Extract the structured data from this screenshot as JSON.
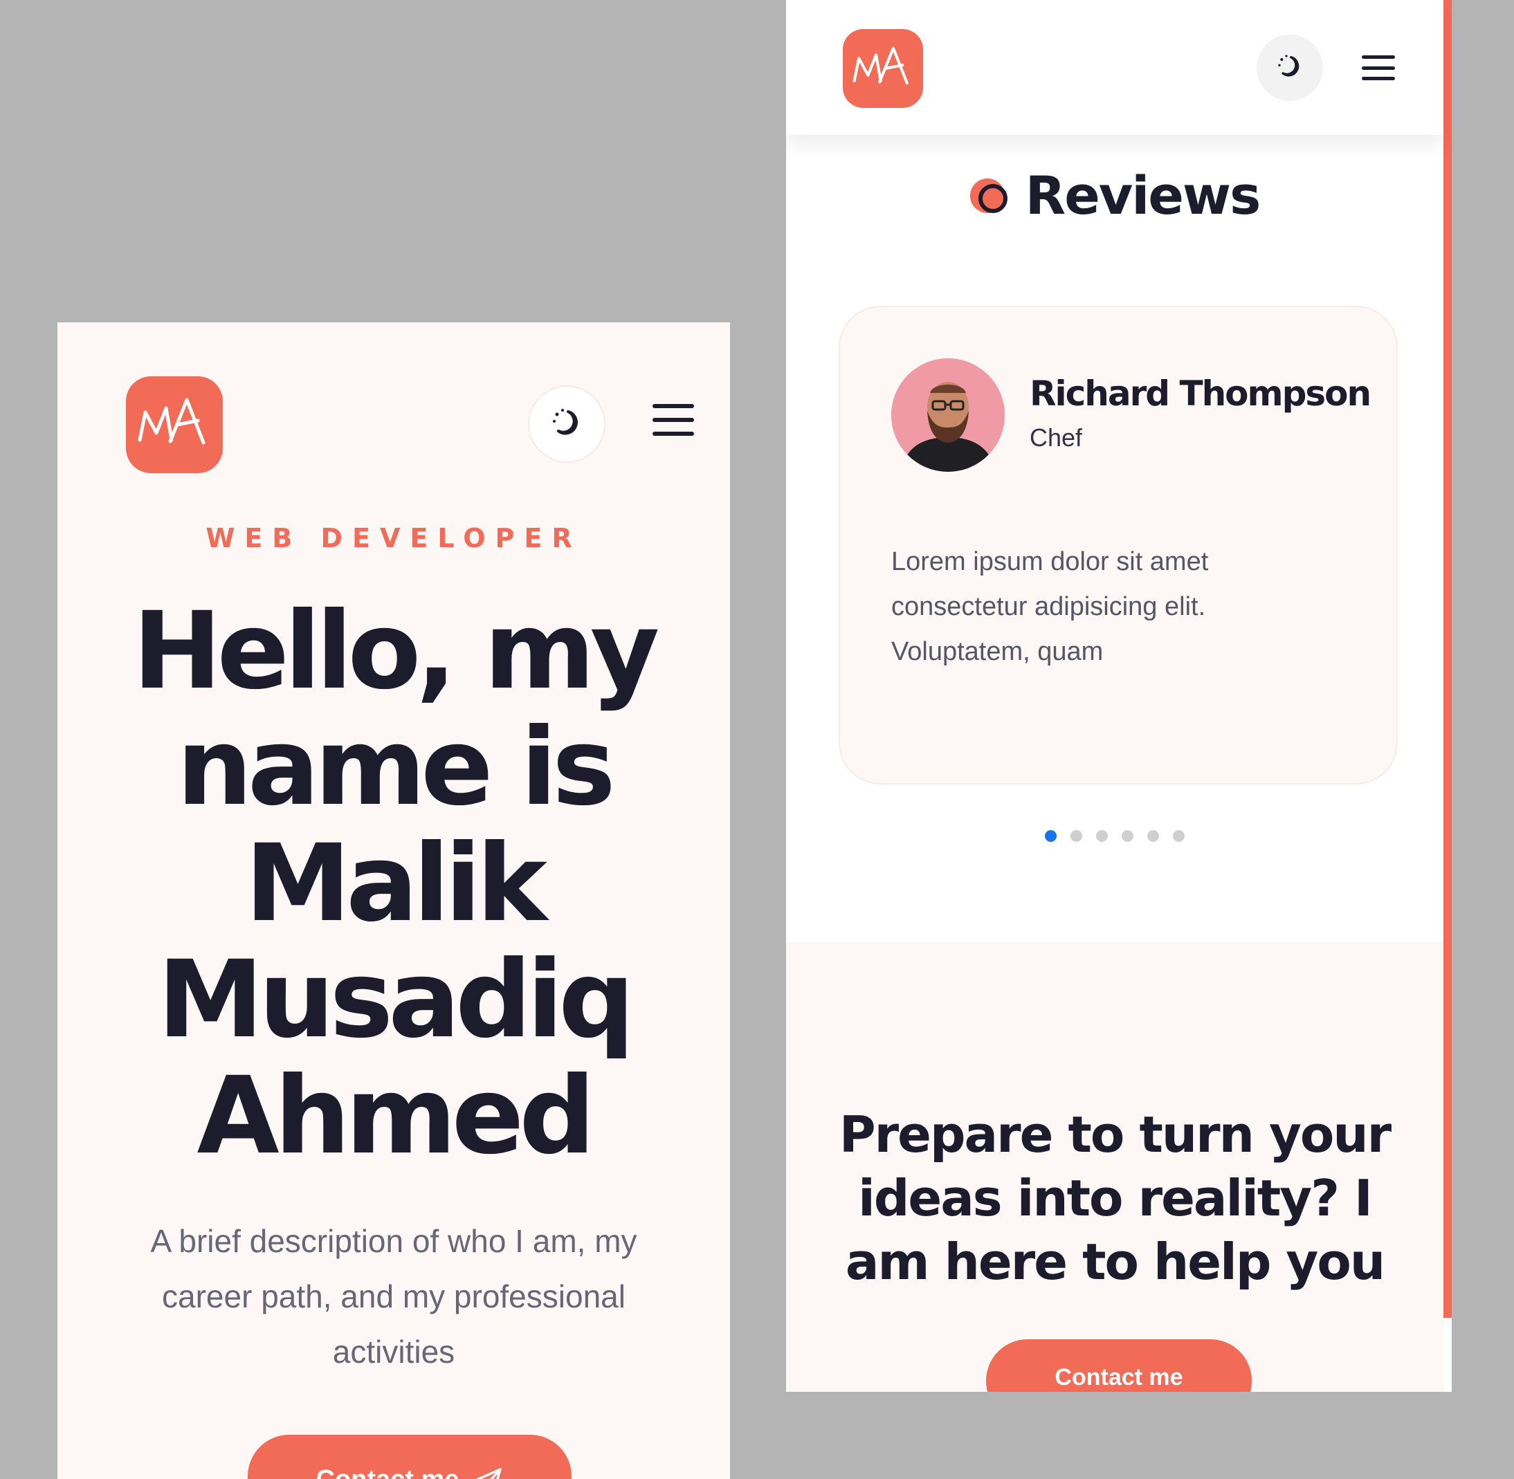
{
  "brand": {
    "logo_text": "MA",
    "accent_color": "#f26b57",
    "dark_color": "#1c1c2c",
    "cream_background": "#fdf8f5"
  },
  "icons": {
    "theme_toggle": "moon-stars-icon",
    "menu": "hamburger-menu-icon",
    "send": "paper-plane-icon"
  },
  "hero": {
    "eyebrow": "WEB DEVELOPER",
    "title_lines": [
      "Hello, my",
      "name is",
      "Malik",
      "Musadiq",
      "Ahmed"
    ],
    "description": "A brief description of who I am, my career path, and my professional activities",
    "cta_label": "Contact me"
  },
  "reviews": {
    "section_title": "Reviews",
    "items": [
      {
        "name": "Richard Thompson",
        "role": "Chef",
        "text": "Lorem ipsum dolor sit amet consectetur adipisicing elit. Voluptatem, quam"
      }
    ],
    "carousel": {
      "total_slides": 6,
      "active_index": 0
    }
  },
  "cta_section": {
    "title": "Prepare to turn your ideas into reality? I am here to help you",
    "button_label": "Contact me"
  }
}
